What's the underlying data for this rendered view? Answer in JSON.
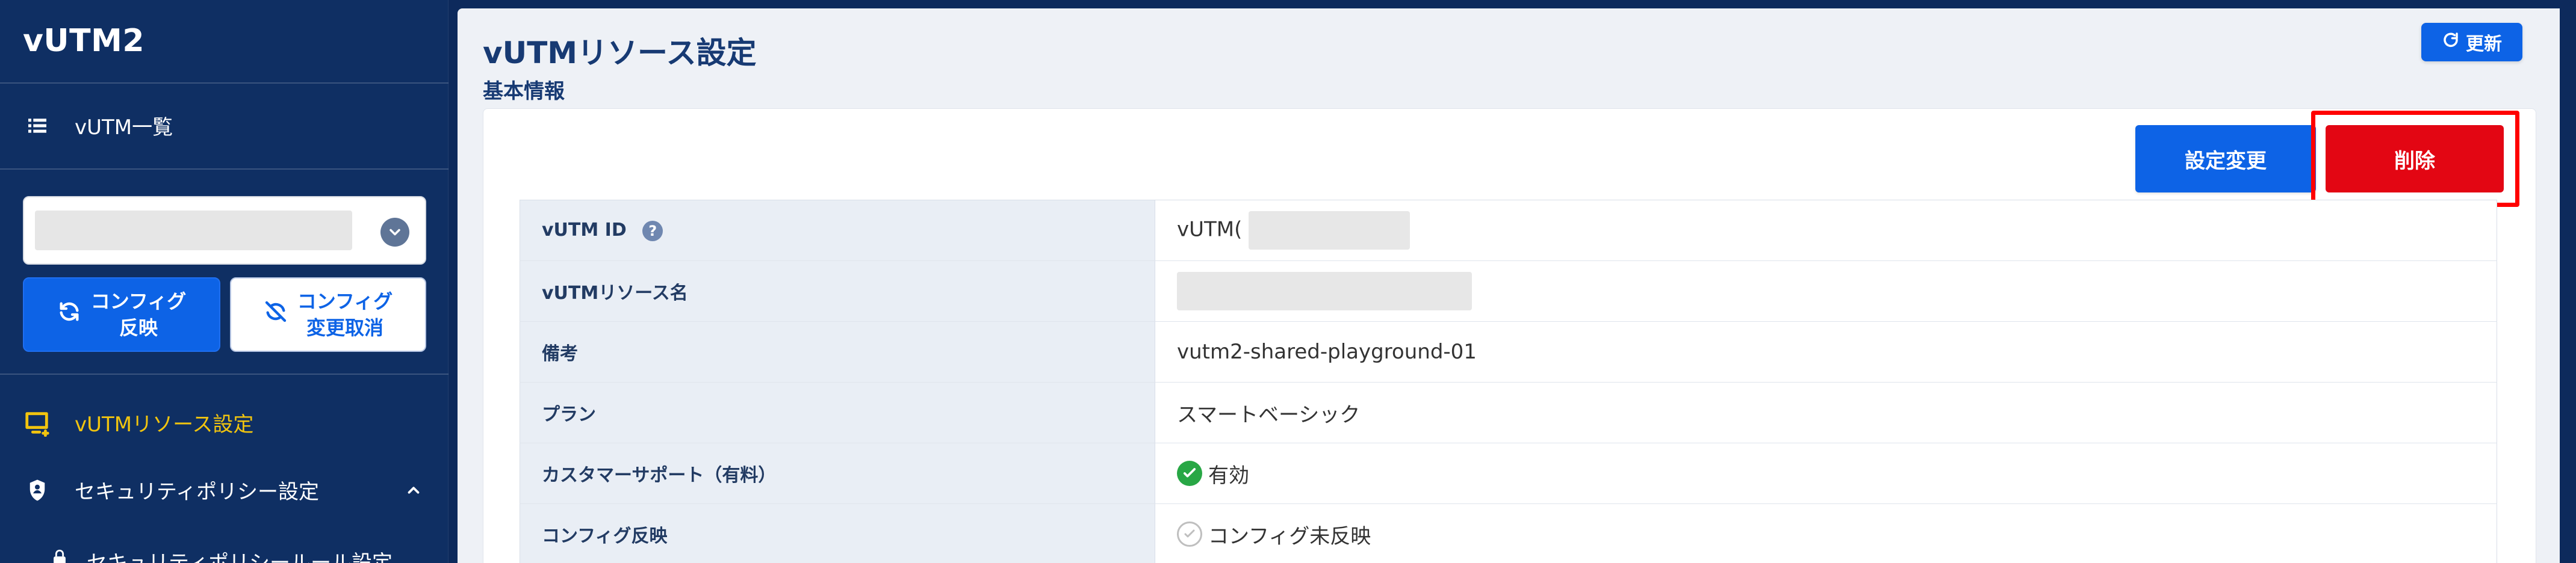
{
  "app": {
    "brand": "vUTM2",
    "colors": {
      "sidebar_bg": "#0f2f63",
      "main_bg": "#eef1f6",
      "primary": "#0d63e6",
      "danger": "#e30613",
      "active_accent": "#f1c40f",
      "highlight": "#ff0000"
    }
  },
  "sidebar": {
    "nav_list": {
      "label": "vUTM一覧",
      "icon": "list-icon"
    },
    "resource_selector": {
      "placeholder": "",
      "icon": "chevron-down-icon"
    },
    "config_apply": {
      "line1": "コンフィグ",
      "line2": "反映",
      "icon": "sync-icon"
    },
    "config_cancel": {
      "line1": "コンフィグ",
      "line2": "変更取消",
      "icon": "sync-disabled-icon"
    },
    "resource_settings": {
      "label": "vUTMリソース設定",
      "icon": "resource-settings-icon"
    },
    "security_policy": {
      "label": "セキュリティポリシー設定",
      "icon": "security-shield-icon"
    },
    "security_policy_rule": {
      "label": "セキュリティポリシールール設定",
      "icon": "lock-icon"
    }
  },
  "main": {
    "title": "vUTMリソース設定",
    "section": "基本情報",
    "refresh": {
      "label": "更新",
      "icon": "refresh-icon"
    },
    "actions": {
      "edit": "設定変更",
      "delete": "削除"
    },
    "rows": [
      {
        "key": "vUTM ID",
        "value": "vUTM(",
        "help": "?"
      },
      {
        "key": "vUTMリソース名",
        "value": ""
      },
      {
        "key": "備考",
        "value": "vutm2-shared-playground-01"
      },
      {
        "key": "プラン",
        "value": "スマートベーシック"
      },
      {
        "key": "カスタマーサポート（有料）",
        "value": "有効",
        "status": "enabled"
      },
      {
        "key": "コンフィグ反映",
        "value": "コンフィグ未反映",
        "status": "not-applied"
      }
    ]
  }
}
